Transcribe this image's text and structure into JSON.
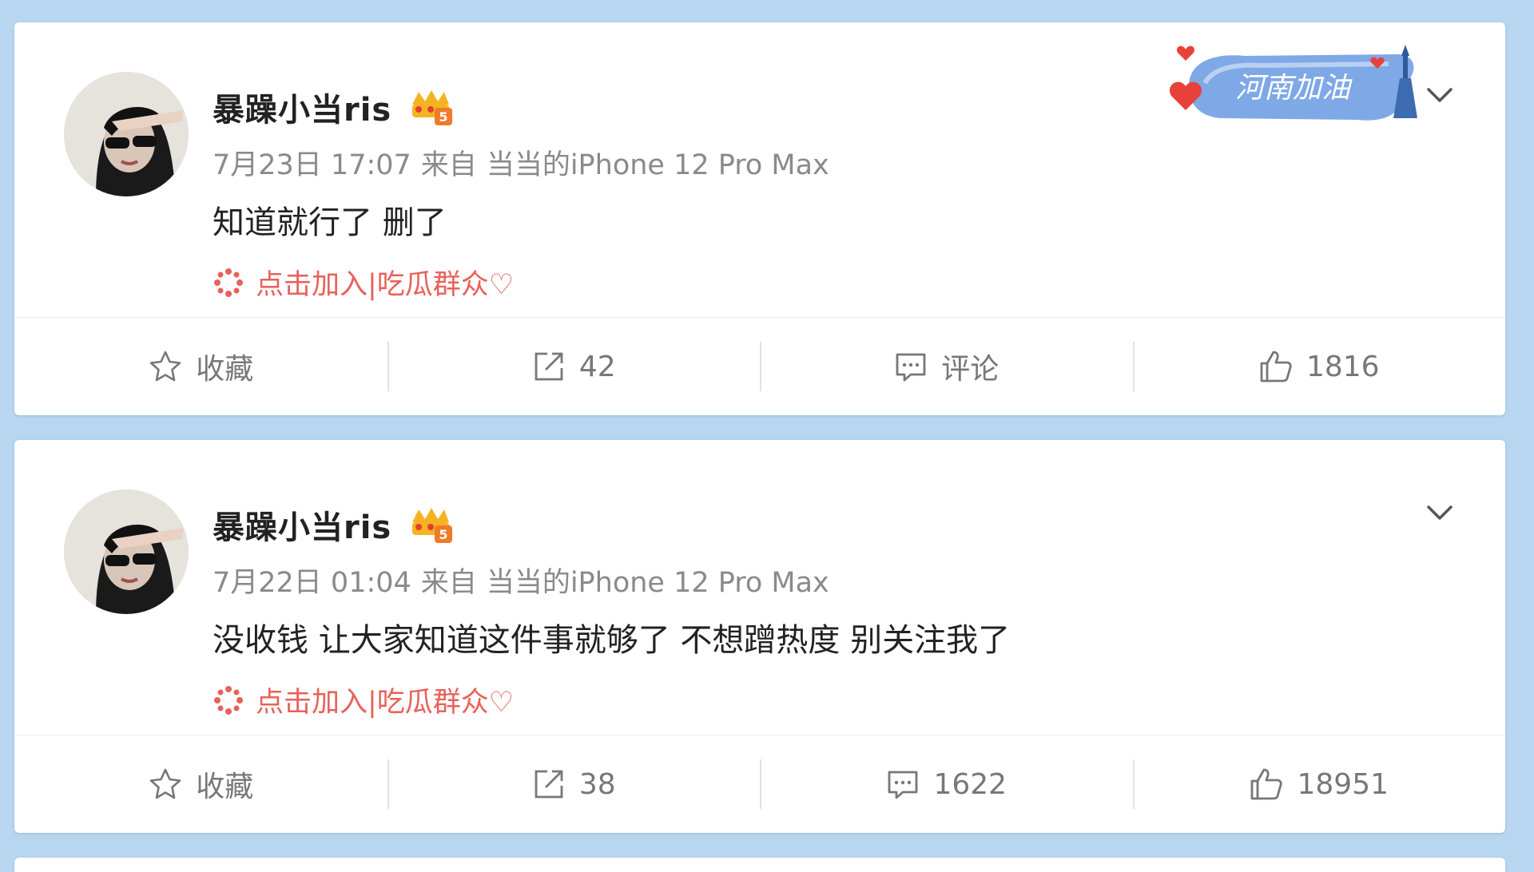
{
  "topic_badge": {
    "text": "河南加油"
  },
  "posts": [
    {
      "username": "暴躁小当ris",
      "date": "7月23日 17:07",
      "source_prefix": "来自",
      "source": "当当的iPhone 12 Pro Max",
      "text": "知道就行了 删了",
      "fan_group": "点击加入|吃瓜群众♡",
      "actions": {
        "favorite": "收藏",
        "repost": "42",
        "comment": "评论",
        "like": "1816"
      }
    },
    {
      "username": "暴躁小当ris",
      "date": "7月22日 01:04",
      "source_prefix": "来自",
      "source": "当当的iPhone 12 Pro Max",
      "text": "没收钱 让大家知道这件事就够了 不想蹭热度 别关注我了",
      "fan_group": "点击加入|吃瓜群众♡",
      "actions": {
        "favorite": "收藏",
        "repost": "38",
        "comment": "1622",
        "like": "18951"
      }
    }
  ],
  "icons": {
    "favorite": "star-outline-icon",
    "repost": "share-icon",
    "comment": "comment-bubble-icon",
    "like": "thumbs-up-icon",
    "menu": "chevron-down-icon",
    "vip": "vip-crown-badge-icon"
  },
  "colors": {
    "accent": "#e8615a",
    "meta": "#8a8a8a",
    "background": "#b8d6ef"
  }
}
